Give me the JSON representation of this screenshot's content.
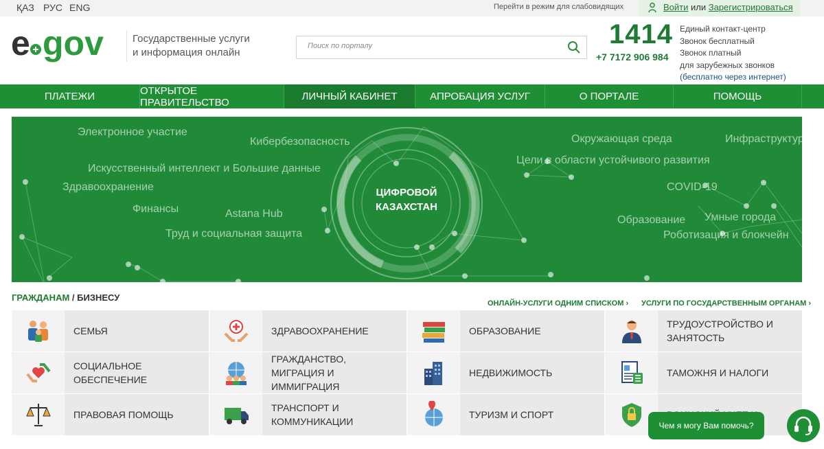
{
  "topbar": {
    "languages": [
      "ҚАЗ",
      "РУС",
      "ENG"
    ],
    "accessible_label": "Перейти в режим для слабовидящих",
    "login": "Войти",
    "or": "или",
    "register": "Зарегистрироваться"
  },
  "header": {
    "logo_text": "egov",
    "tagline_line1": "Государственные услуги",
    "tagline_line2": "и информация онлайн",
    "search_placeholder": "Поиск по порталу",
    "phone_main": "1414",
    "phone_alt": "+7 7172 906 984",
    "contact_line1": "Единый контакт-центр",
    "contact_line2": "Звонок бесплатный",
    "contact_line3": "Звонок платный",
    "contact_line4": "для зарубежных звонков",
    "contact_line5": "(бесплатно через интернет)"
  },
  "nav": {
    "items": [
      {
        "label": "ПЛАТЕЖИ"
      },
      {
        "label": "ОТКРЫТОЕ ПРАВИТЕЛЬСТВО"
      },
      {
        "label": "ЛИЧНЫЙ КАБИНЕТ"
      },
      {
        "label": "АПРОБАЦИЯ УСЛУГ"
      },
      {
        "label": "О ПОРТАЛЕ"
      },
      {
        "label": "ПОМОЩЬ"
      }
    ]
  },
  "banner": {
    "center_line1": "ЦИФРОВОЙ",
    "center_line2": "КАЗАХСТАН",
    "labels": [
      "Электронное участие",
      "Кибербезопасность",
      "Искусственный интеллект и Большие данные",
      "Здравоохранение",
      "Финансы",
      "Astana Hub",
      "Труд и социальная защита",
      "Окружающая среда",
      "Инфраструктура",
      "Цели в области устойчивого развития",
      "COVID-19",
      "Образование",
      "Умные города",
      "Роботизация и блокчейн"
    ]
  },
  "section": {
    "title_citizens": "ГРАЖДАНАМ",
    "title_sep": " / ",
    "title_business": "БИЗНЕСУ",
    "link_online": "ОНЛАЙН-УСЛУГИ ОДНИМ СПИСКОМ ›",
    "link_agencies": "УСЛУГИ ПО ГОСУДАРСТВЕННЫМ ОРГАНАМ ›"
  },
  "tiles": [
    {
      "label": "СЕМЬЯ",
      "icon": "family-icon"
    },
    {
      "label": "ЗДРАВООХРАНЕНИЕ",
      "icon": "healthcare-icon"
    },
    {
      "label": "ОБРАЗОВАНИЕ",
      "icon": "books-icon"
    },
    {
      "label": "ТРУДОУСТРОЙСТВО И ЗАНЯТОСТЬ",
      "icon": "employee-icon"
    },
    {
      "label": "СОЦИАЛЬНОЕ ОБЕСПЕЧЕНИЕ",
      "icon": "social-care-icon"
    },
    {
      "label": "ГРАЖДАНСТВО, МИГРАЦИЯ И ИММИГРАЦИЯ",
      "icon": "globe-people-icon"
    },
    {
      "label": "НЕДВИЖИМОСТЬ",
      "icon": "buildings-icon"
    },
    {
      "label": "ТАМОЖНЯ И НАЛОГИ",
      "icon": "tax-document-icon"
    },
    {
      "label": "ПРАВОВАЯ ПОМОЩЬ",
      "icon": "scales-icon"
    },
    {
      "label": "ТРАНСПОРТ И КОММУНИКАЦИИ",
      "icon": "truck-icon"
    },
    {
      "label": "ТУРИЗМ И СПОРТ",
      "icon": "globe-pin-icon"
    },
    {
      "label": "ВОИНСКИЙ УЧЕТ И",
      "icon": "shield-lock-icon"
    }
  ],
  "chat": {
    "bubble": "Чем я могу Вам помочь?"
  },
  "colors": {
    "brand_green": "#1f8f35",
    "banner_green": "#218a38",
    "tile_bg": "#e9e9e9"
  }
}
